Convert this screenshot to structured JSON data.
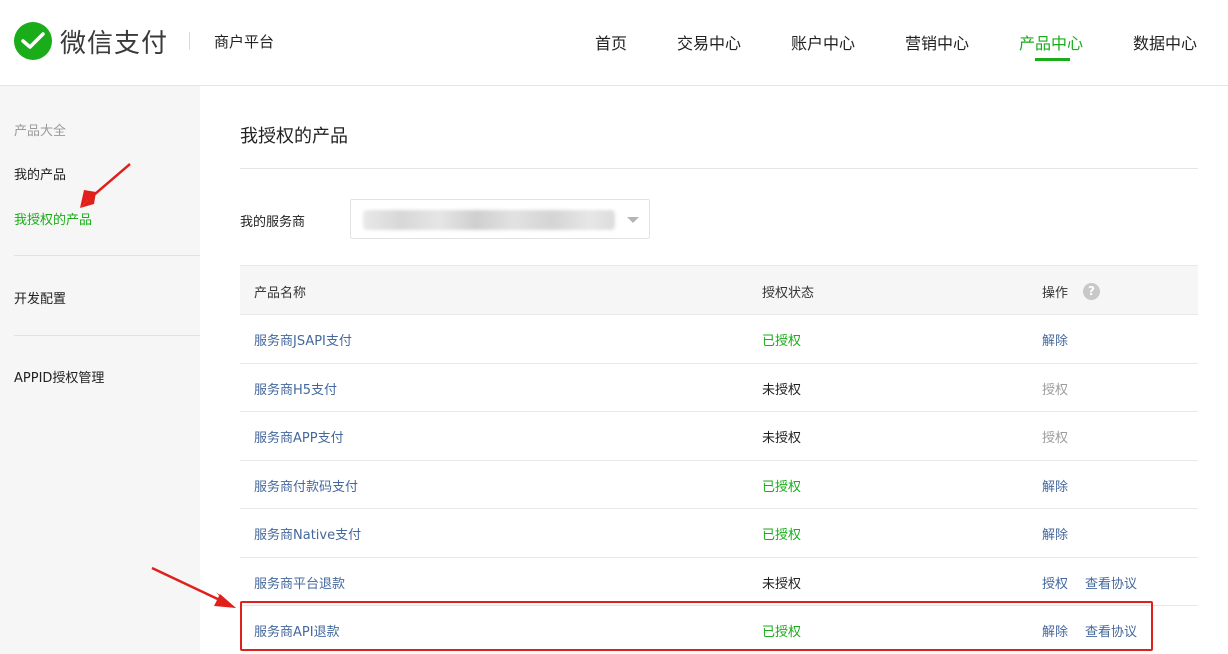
{
  "header": {
    "brand": "微信支付",
    "platform": "商户平台",
    "nav": [
      "首页",
      "交易中心",
      "账户中心",
      "营销中心",
      "产品中心",
      "数据中心"
    ],
    "active_nav": "产品中心"
  },
  "sidebar": {
    "group_title": "产品大全",
    "items": [
      "我的产品",
      "我授权的产品",
      "开发配置",
      "APPID授权管理"
    ],
    "active_item": "我授权的产品"
  },
  "main": {
    "title": "我授权的产品",
    "filter_label": "我的服务商",
    "table": {
      "columns": [
        "产品名称",
        "授权状态",
        "操作"
      ],
      "help_glyph": "?",
      "rows": [
        {
          "name": "服务商JSAPI支付",
          "status": "已授权",
          "actions": [
            "解除"
          ]
        },
        {
          "name": "服务商H5支付",
          "status": "未授权",
          "actions": [
            "授权"
          ]
        },
        {
          "name": "服务商APP支付",
          "status": "未授权",
          "actions": [
            "授权"
          ]
        },
        {
          "name": "服务商付款码支付",
          "status": "已授权",
          "actions": [
            "解除"
          ]
        },
        {
          "name": "服务商Native支付",
          "status": "已授权",
          "actions": [
            "解除"
          ]
        },
        {
          "name": "服务商平台退款",
          "status": "未授权",
          "actions": [
            "授权",
            "查看协议"
          ]
        },
        {
          "name": "服务商API退款",
          "status": "已授权",
          "actions": [
            "解除",
            "查看协议"
          ]
        }
      ]
    }
  },
  "colors": {
    "brand_green": "#1aad19",
    "link_blue": "#44689e",
    "annotation_red": "#e0201b"
  }
}
